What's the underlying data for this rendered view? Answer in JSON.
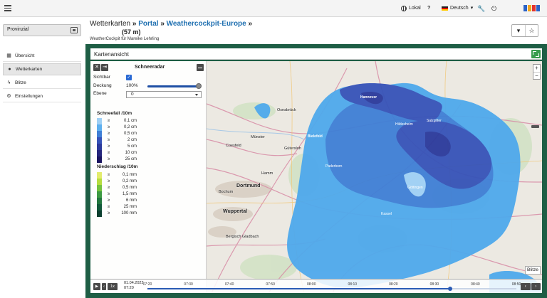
{
  "topbar": {
    "location": "Lokal",
    "help": "?",
    "language": "Deutsch",
    "logo_colors": [
      "#2b63c6",
      "#f3a51c",
      "#e3342f",
      "#2b63c6"
    ]
  },
  "account": {
    "name": "Provinzial"
  },
  "header": {
    "crumb_root": "Wetterkarten",
    "crumb_portal": "Portal",
    "crumb_current": "Weathercockpit-Europe",
    "elevation": "(57 m)",
    "subtitle": "WeatherCockpit für Mareike Lehrling"
  },
  "sidebar": {
    "items": [
      {
        "label": "Übersicht",
        "icon": "grid-icon"
      },
      {
        "label": "Wetterkarten",
        "icon": "globe-icon"
      },
      {
        "label": "Blitze",
        "icon": "lightning-icon"
      },
      {
        "label": "Einstellungen",
        "icon": "gears-icon"
      }
    ]
  },
  "panel": {
    "title": "Kartenansicht"
  },
  "overlay": {
    "title": "Schneeradar",
    "visible_label": "Sichtbar",
    "coverage_label": "Deckung",
    "coverage_value": "100%",
    "coverage_fraction": 1.0,
    "layer_label": "Ebene",
    "layer_value": "0",
    "snow_heading": "Schneefall /10m",
    "snow_legend": [
      {
        "ge": "≥",
        "value": "0,1 cm",
        "color": "#9fd0f5"
      },
      {
        "ge": "≥",
        "value": "0,2 cm",
        "color": "#5eb0ef"
      },
      {
        "ge": "≥",
        "value": "0,5 cm",
        "color": "#3f7fd6"
      },
      {
        "ge": "≥",
        "value": "2 cm",
        "color": "#3653b8"
      },
      {
        "ge": "≥",
        "value": "5 cm",
        "color": "#2b3a9c"
      },
      {
        "ge": "≥",
        "value": "10 cm",
        "color": "#25267c"
      },
      {
        "ge": "≥",
        "value": "25 cm",
        "color": "#1a1560"
      }
    ],
    "rain_heading": "Niederschlag /10m",
    "rain_legend": [
      {
        "ge": "≥",
        "value": "0,1 mm",
        "color": "#e3ec6d"
      },
      {
        "ge": "≥",
        "value": "0,2 mm",
        "color": "#b6dd3f"
      },
      {
        "ge": "≥",
        "value": "0,5 mm",
        "color": "#74c23f"
      },
      {
        "ge": "≥",
        "value": "1,5 mm",
        "color": "#3d9a43"
      },
      {
        "ge": "≥",
        "value": "6 mm",
        "color": "#23773f"
      },
      {
        "ge": "≥",
        "value": "25 mm",
        "color": "#135a3b"
      },
      {
        "ge": "≥",
        "value": "100 mm",
        "color": "#0c3f30"
      }
    ]
  },
  "map": {
    "cities": [
      {
        "name": "Hannover",
        "big": true,
        "inrad": true
      },
      {
        "name": "Bielefeld",
        "big": true,
        "inrad": true
      },
      {
        "name": "Dortmund",
        "big": true,
        "inrad": false
      },
      {
        "name": "Bochum",
        "big": false,
        "inrad": false
      },
      {
        "name": "Wuppertal",
        "big": false,
        "inrad": false
      },
      {
        "name": "Münster",
        "big": false,
        "inrad": false
      },
      {
        "name": "Osnabrück",
        "big": false,
        "inrad": false
      },
      {
        "name": "Paderborn",
        "big": false,
        "inrad": true
      },
      {
        "name": "Hildesheim",
        "big": false,
        "inrad": true
      },
      {
        "name": "Salzgitter",
        "big": false,
        "inrad": true
      },
      {
        "name": "Gütersloh",
        "big": false,
        "inrad": false
      },
      {
        "name": "Hamm",
        "big": false,
        "inrad": false
      },
      {
        "name": "Coesfeld",
        "big": false,
        "inrad": false
      },
      {
        "name": "Bergisch Gladbach",
        "big": false,
        "inrad": false
      },
      {
        "name": "Kassel",
        "big": false,
        "inrad": true
      },
      {
        "name": "Göttingen",
        "big": false,
        "inrad": true
      }
    ],
    "blitze_label": "Blitze"
  },
  "timeline": {
    "date": "01.04.2022",
    "start_time": "07:20",
    "speed": "1x",
    "ticks": [
      "07:20",
      "07:30",
      "07:40",
      "07:50",
      "08:00",
      "08:10",
      "08:20",
      "08:30",
      "08:40",
      "08:50"
    ],
    "progress_fraction": 0.82
  }
}
